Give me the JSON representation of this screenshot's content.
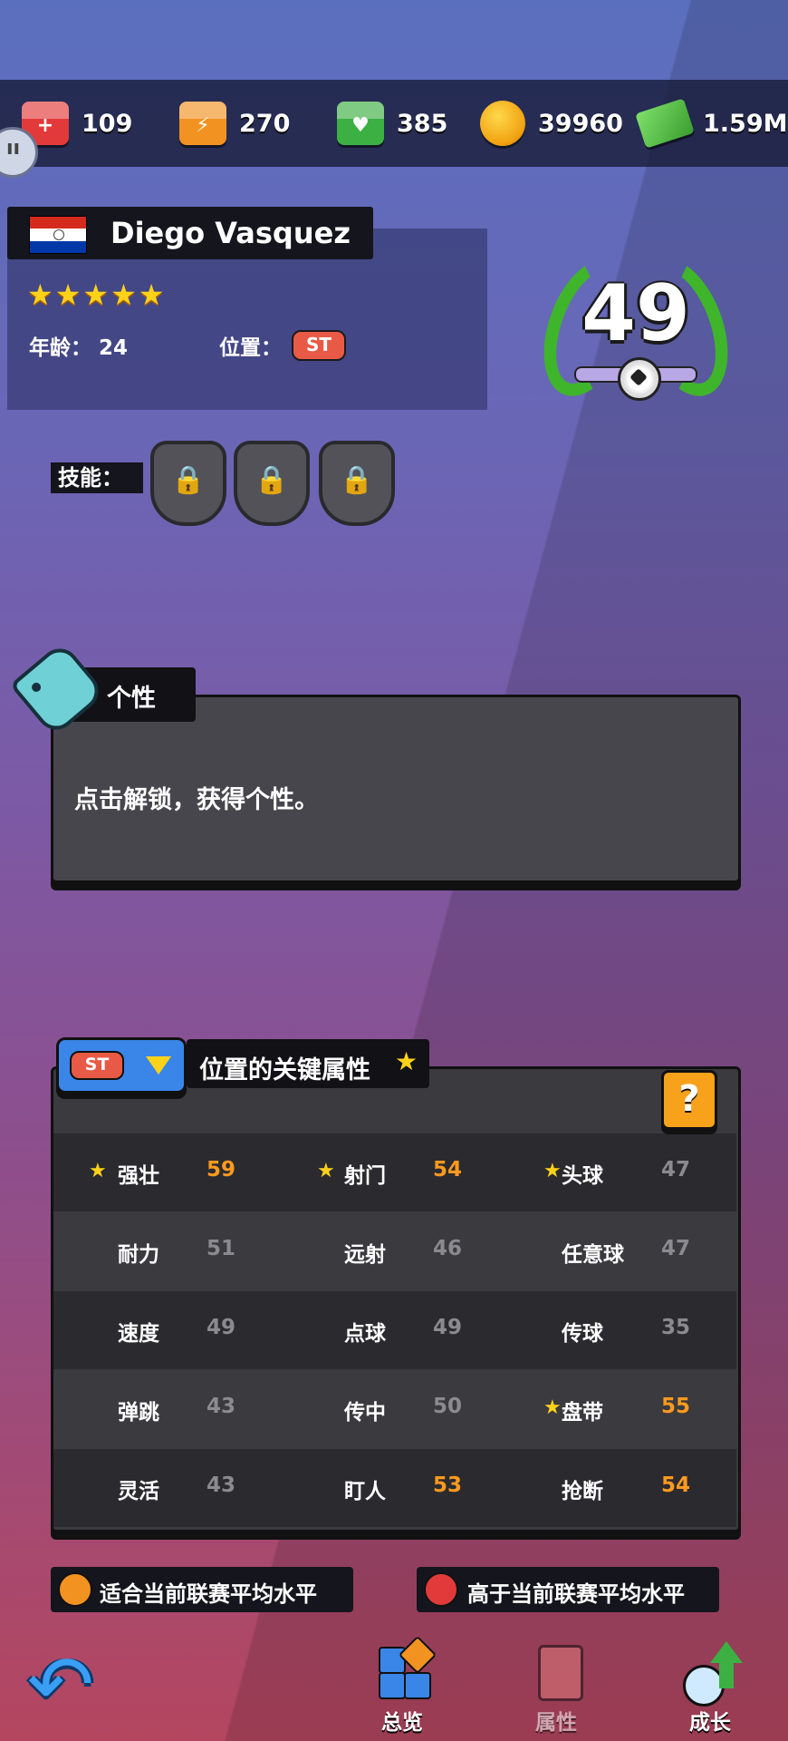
{
  "resources": [
    {
      "name": "red-cube",
      "value": "109",
      "color": "#e23a3a",
      "glyph": "+"
    },
    {
      "name": "orange-cube",
      "value": "270",
      "color": "#f29321",
      "glyph": "⚡"
    },
    {
      "name": "green-cube",
      "value": "385",
      "color": "#3cb043",
      "glyph": "♥"
    },
    {
      "name": "gold-coin",
      "value": "39960"
    },
    {
      "name": "cash",
      "value": "1.59M"
    }
  ],
  "player": {
    "name": "Diego Vasquez",
    "stars": "★★★★★",
    "age_label": "年龄： 24",
    "position_label": "位置：",
    "position": "ST",
    "rating": "49"
  },
  "skills": {
    "label": "技能：",
    "slots": [
      "🔒",
      "🔒",
      "🔒"
    ]
  },
  "trait": {
    "title": "个性",
    "text": "点击解锁，获得个性。"
  },
  "key_attributes": {
    "position": "ST",
    "title": "位置的关键属性",
    "help": "?",
    "rows": [
      [
        {
          "label": "强壮",
          "value": "59",
          "key": true,
          "high": true
        },
        {
          "label": "射门",
          "value": "54",
          "key": true,
          "high": true
        },
        {
          "label": "头球",
          "value": "47",
          "key": true,
          "high": false
        }
      ],
      [
        {
          "label": "耐力",
          "value": "51",
          "key": false,
          "high": false
        },
        {
          "label": "远射",
          "value": "46",
          "key": false,
          "high": false
        },
        {
          "label": "任意球",
          "value": "47",
          "key": false,
          "high": false
        }
      ],
      [
        {
          "label": "速度",
          "value": "49",
          "key": false,
          "high": false
        },
        {
          "label": "点球",
          "value": "49",
          "key": false,
          "high": false
        },
        {
          "label": "传球",
          "value": "35",
          "key": false,
          "high": false
        }
      ],
      [
        {
          "label": "弹跳",
          "value": "43",
          "key": false,
          "high": false
        },
        {
          "label": "传中",
          "value": "50",
          "key": false,
          "high": false
        },
        {
          "label": "盘带",
          "value": "55",
          "key": true,
          "high": true
        }
      ],
      [
        {
          "label": "灵活",
          "value": "43",
          "key": false,
          "high": false
        },
        {
          "label": "盯人",
          "value": "53",
          "key": false,
          "high": true
        },
        {
          "label": "抢断",
          "value": "54",
          "key": false,
          "high": true
        }
      ]
    ]
  },
  "legend": [
    {
      "text": "适合当前联赛平均水平",
      "color": "#f29321"
    },
    {
      "text": "高于当前联赛平均水平",
      "color": "#e23a3a"
    }
  ],
  "nav": {
    "back": "↶",
    "overview": "总览",
    "attributes": "属性",
    "growth": "成长"
  }
}
